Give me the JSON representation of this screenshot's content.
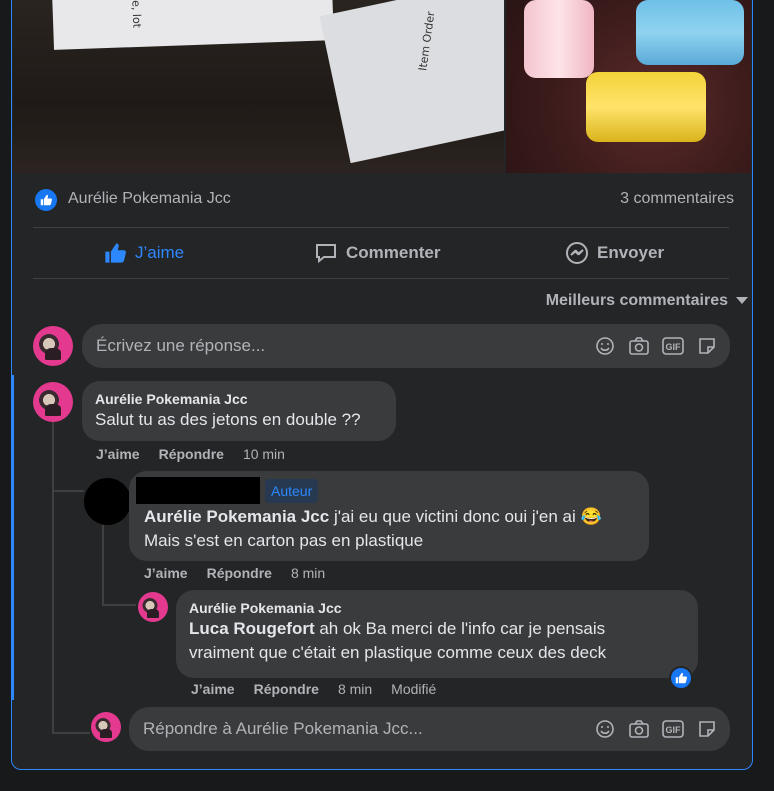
{
  "post": {
    "reactor_name": "Aurélie Pokemania Jcc",
    "comment_count": "3 commentaires"
  },
  "photos": {
    "left_paper_text": "Item Order",
    "left_note_text": "uillie, lot"
  },
  "actions": {
    "like_label": "J’aime",
    "comment_label": "Commenter",
    "send_label": "Envoyer"
  },
  "sort": {
    "label": "Meilleurs commentaires"
  },
  "reply_box": {
    "placeholder": "Écrivez une réponse..."
  },
  "comments": [
    {
      "author": "Aurélie Pokemania Jcc",
      "text": "Salut tu as des jetons en double ??",
      "like": "J’aime",
      "reply": "Répondre",
      "time": "10 min"
    },
    {
      "badge": "Auteur",
      "mention": "Aurélie Pokemania Jcc",
      "text_1": " j'ai eu que victini donc oui j'en ai 😂",
      "text_2": "Mais s'est en carton pas en plastique",
      "like": "J’aime",
      "reply": "Répondre",
      "time": "8 min"
    },
    {
      "author": "Aurélie Pokemania Jcc",
      "mention": "Luca Rougefort",
      "text_1": " ah ok Ba merci de l'info car je pensais",
      "text_2": "vraiment que c'était en plastique comme ceux des deck",
      "like": "J’aime",
      "reply": "Répondre",
      "time": "8 min",
      "edited": "Modifié"
    }
  ],
  "thread_reply_box": {
    "placeholder": "Répondre à Aurélie Pokemania Jcc..."
  },
  "colors": {
    "accent": "#2d88ff",
    "bubble": "#3a3b3c",
    "card": "#242526"
  }
}
